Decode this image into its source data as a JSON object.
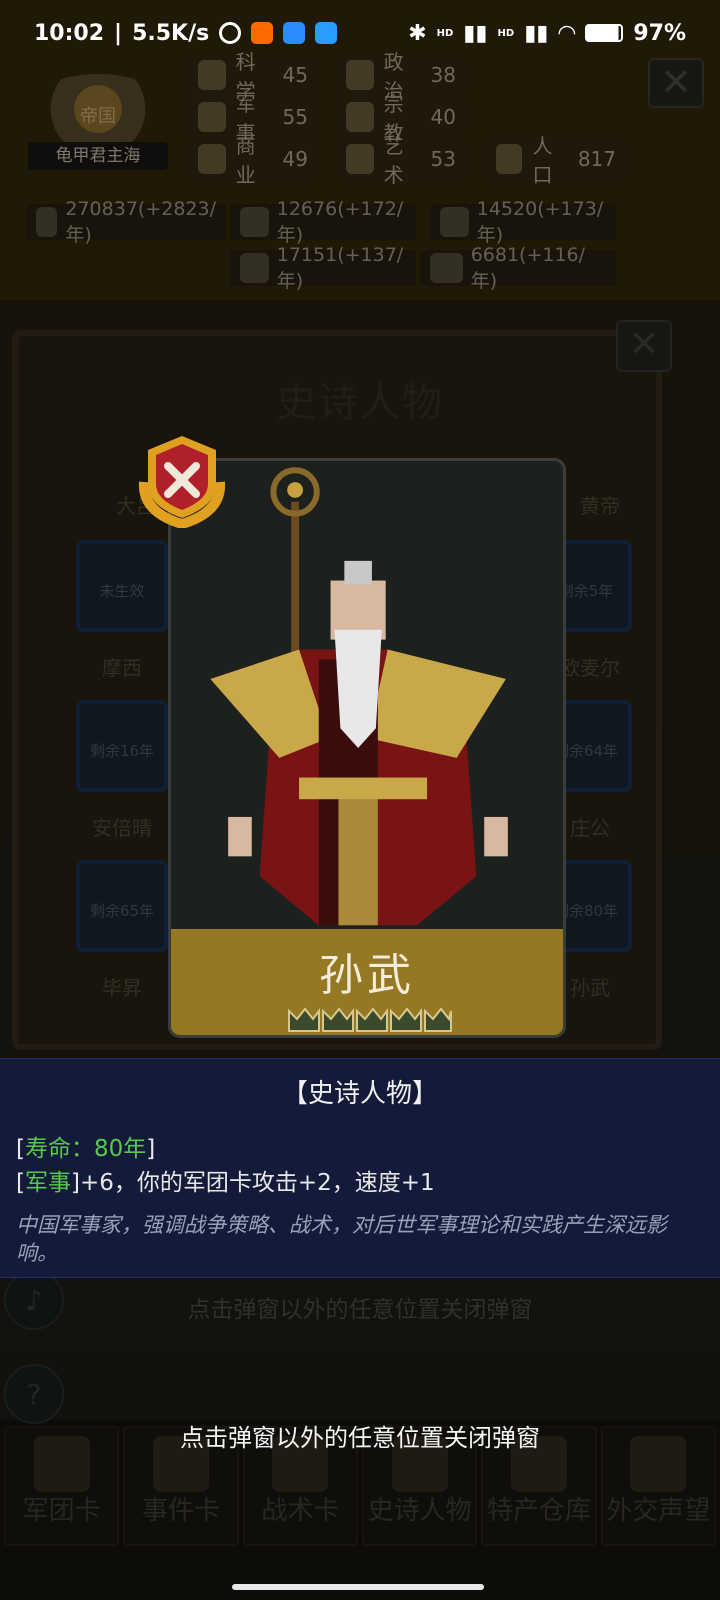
{
  "status_bar": {
    "time": "10:02",
    "network_speed": "5.5K/s",
    "battery": "97%",
    "signal_labels": [
      "HD",
      "HD"
    ]
  },
  "empire": {
    "title": "帝国",
    "player_name": "龟甲君主海"
  },
  "stats": [
    {
      "label": "科学",
      "value": "45"
    },
    {
      "label": "政治",
      "value": "38"
    },
    {
      "label": "军事",
      "value": "55"
    },
    {
      "label": "宗教",
      "value": "40"
    },
    {
      "label": "商业",
      "value": "49"
    },
    {
      "label": "艺术",
      "value": "53"
    },
    {
      "label": "人口",
      "value": "817"
    }
  ],
  "resources": [
    "270837(+2823/年)",
    "12676(+172/年)",
    "14520(+173/年)",
    "17151(+137/年)",
    "6681(+116/年)"
  ],
  "panel": {
    "title": "史诗人物",
    "cards": [
      {
        "status": "未生效",
        "name": "摩西"
      },
      {
        "status": "剩余16年",
        "name": "安倍晴"
      },
      {
        "status": "剩余65年",
        "name": "毕昇"
      },
      {
        "status": "剩余5年",
        "name": "欧麦尔"
      },
      {
        "status": "剩余64年",
        "name": "庄公"
      },
      {
        "status": "剩余80年",
        "name": "孙武"
      }
    ],
    "partial_names": [
      "大吕",
      "黄帝"
    ]
  },
  "hero": {
    "name": "孙武",
    "crown_count": 5,
    "category_title": "【史诗人物】",
    "lifespan_label": "寿命：80年",
    "effect_tag": "军事",
    "effect_text": "+6，你的军团卡攻击+2，速度+1",
    "description": "中国军事家，强调战争策略、战术，对后世军事理论和实践产生深远影响。"
  },
  "close_hint": "点击弹窗以外的任意位置关闭弹窗",
  "nav": [
    {
      "label": "军团卡"
    },
    {
      "label": "事件卡"
    },
    {
      "label": "战术卡"
    },
    {
      "label": "史诗人物"
    },
    {
      "label": "特产仓库"
    },
    {
      "label": "外交声望"
    }
  ],
  "colors": {
    "info_bg": "#141b3a",
    "highlight_green": "#57c84a",
    "name_band": "#a08024",
    "medal_red": "#b0202a",
    "medal_gold": "#e0a020"
  }
}
